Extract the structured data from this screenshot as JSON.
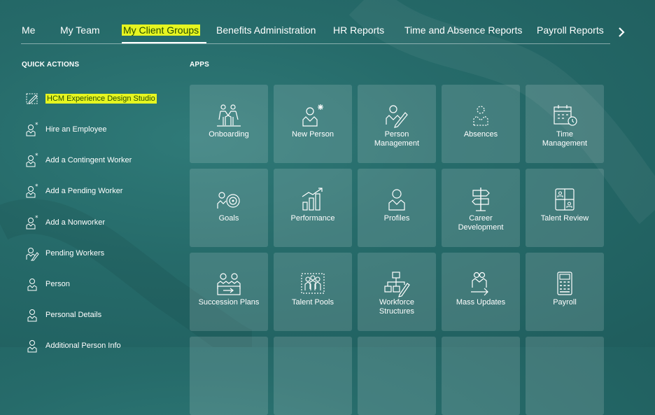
{
  "tabs": [
    {
      "label": "Me"
    },
    {
      "label": "My Team"
    },
    {
      "label": "My Client Groups"
    },
    {
      "label": "Benefits Administration"
    },
    {
      "label": "HR Reports"
    },
    {
      "label": "Time and Absence Reports"
    },
    {
      "label": "Payroll Reports"
    }
  ],
  "quick_actions": {
    "title": "QUICK ACTIONS",
    "items": [
      {
        "label": "HCM Experience Design Studio",
        "icon": "design-studio-icon"
      },
      {
        "label": "Hire an Employee",
        "icon": "person-add-icon"
      },
      {
        "label": "Add a Contingent Worker",
        "icon": "person-add-icon"
      },
      {
        "label": "Add a Pending Worker",
        "icon": "person-add-icon"
      },
      {
        "label": "Add a Nonworker",
        "icon": "person-add-icon"
      },
      {
        "label": "Pending Workers",
        "icon": "person-edit-icon"
      },
      {
        "label": "Person",
        "icon": "person-icon"
      },
      {
        "label": "Personal Details",
        "icon": "person-icon"
      },
      {
        "label": "Additional Person Info",
        "icon": "person-icon"
      }
    ]
  },
  "apps": {
    "title": "APPS",
    "tiles": [
      {
        "label": "Onboarding",
        "icon": "onboarding-icon"
      },
      {
        "label": "New Person",
        "icon": "new-person-icon"
      },
      {
        "label": "Person Management",
        "icon": "person-management-icon"
      },
      {
        "label": "Absences",
        "icon": "absences-icon"
      },
      {
        "label": "Time Management",
        "icon": "time-management-icon"
      },
      {
        "label": "Goals",
        "icon": "goals-icon"
      },
      {
        "label": "Performance",
        "icon": "performance-icon"
      },
      {
        "label": "Profiles",
        "icon": "profiles-icon"
      },
      {
        "label": "Career Development",
        "icon": "career-development-icon"
      },
      {
        "label": "Talent Review",
        "icon": "talent-review-icon"
      },
      {
        "label": "Succession Plans",
        "icon": "succession-plans-icon"
      },
      {
        "label": "Talent Pools",
        "icon": "talent-pools-icon"
      },
      {
        "label": "Workforce Structures",
        "icon": "workforce-structures-icon"
      },
      {
        "label": "Mass Updates",
        "icon": "mass-updates-icon"
      },
      {
        "label": "Payroll",
        "icon": "payroll-icon"
      }
    ]
  },
  "colors": {
    "highlight": "#e6f520",
    "background": "#266b6a",
    "tile": "rgba(255,255,255,0.14)"
  }
}
